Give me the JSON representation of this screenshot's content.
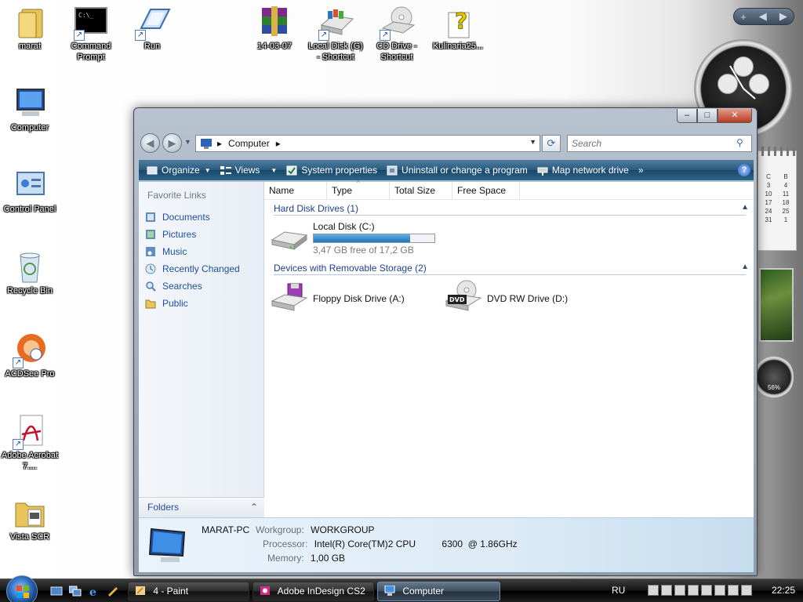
{
  "desktop": {
    "icons": [
      {
        "label": "marat",
        "icon": "user-folder-icon"
      },
      {
        "label": "Command Prompt",
        "icon": "command-prompt-icon"
      },
      {
        "label": "Run",
        "icon": "run-icon"
      },
      {
        "label": "14-03-07",
        "icon": "winrar-archive-icon"
      },
      {
        "label": "Local Disk (G) - Shortcut",
        "icon": "local-disk-icon"
      },
      {
        "label": "CD Drive - Shortcut",
        "icon": "cd-drive-icon"
      },
      {
        "label": "Kulinaria25...",
        "icon": "unknown-file-icon"
      },
      {
        "label": "Computer",
        "icon": "computer-icon"
      },
      {
        "label": "Control Panel",
        "icon": "control-panel-icon"
      },
      {
        "label": "Recycle Bin",
        "icon": "recycle-bin-icon"
      },
      {
        "label": "ACDSee Pro",
        "icon": "acdsee-icon"
      },
      {
        "label": "Adobe Acrobat 7....",
        "icon": "adobe-acrobat-icon"
      },
      {
        "label": "Vista SCR",
        "icon": "folder-icon"
      }
    ]
  },
  "sidebar": {
    "toolbar_add": "+",
    "calendar": {
      "headers": [
        "C",
        "B"
      ],
      "days": [
        "3",
        "4",
        "10",
        "11",
        "17",
        "18",
        "24",
        "25",
        "31",
        "1"
      ]
    },
    "meter_value": "56%"
  },
  "window": {
    "caption": {
      "minimize": "–",
      "maximize": "□",
      "close": "✕"
    },
    "nav": {
      "back": "◀",
      "forward": "▶"
    },
    "address": {
      "path": "Computer",
      "separator": "▸"
    },
    "search": {
      "placeholder": "Search"
    },
    "toolbar": {
      "organize": "Organize",
      "views": "Views",
      "system_properties": "System properties",
      "uninstall": "Uninstall or change a program",
      "map_drive": "Map network drive",
      "more": "»",
      "help": "?"
    },
    "nav_pane": {
      "title": "Favorite Links",
      "links": [
        "Documents",
        "Pictures",
        "Music",
        "Recently Changed",
        "Searches",
        "Public"
      ],
      "folders": "Folders"
    },
    "columns": [
      "Name",
      "Type",
      "Total Size",
      "Free Space"
    ],
    "groups": {
      "hard_disks": "Hard Disk Drives (1)",
      "removable": "Devices with Removable Storage (2)"
    },
    "drives": {
      "local": {
        "name": "Local Disk (C:)",
        "free": "3,47 GB free of 17,2 GB",
        "used_fraction": 0.8
      },
      "floppy": {
        "name": "Floppy Disk Drive (A:)"
      },
      "dvd": {
        "name": "DVD RW Drive (D:)",
        "badge": "DVD"
      }
    },
    "details": {
      "pc_name": "MARAT-PC",
      "workgroup_label": "Workgroup:",
      "workgroup": "WORKGROUP",
      "processor_label": "Processor:",
      "processor": "Intel(R) Core(TM)2 CPU          6300  @ 1.86GHz",
      "memory_label": "Memory:",
      "memory": "1,00 GB"
    }
  },
  "taskbar": {
    "tasks": [
      {
        "label": "4 - Paint",
        "active": false
      },
      {
        "label": "Adobe InDesign CS2",
        "active": false
      },
      {
        "label": "Computer",
        "active": true
      }
    ],
    "language": "RU",
    "time": "22:25"
  },
  "colors": {
    "link_blue": "#1e4f9e",
    "toolbar_blue": "#285a7e",
    "capacity_fill": "#1f73b8"
  }
}
